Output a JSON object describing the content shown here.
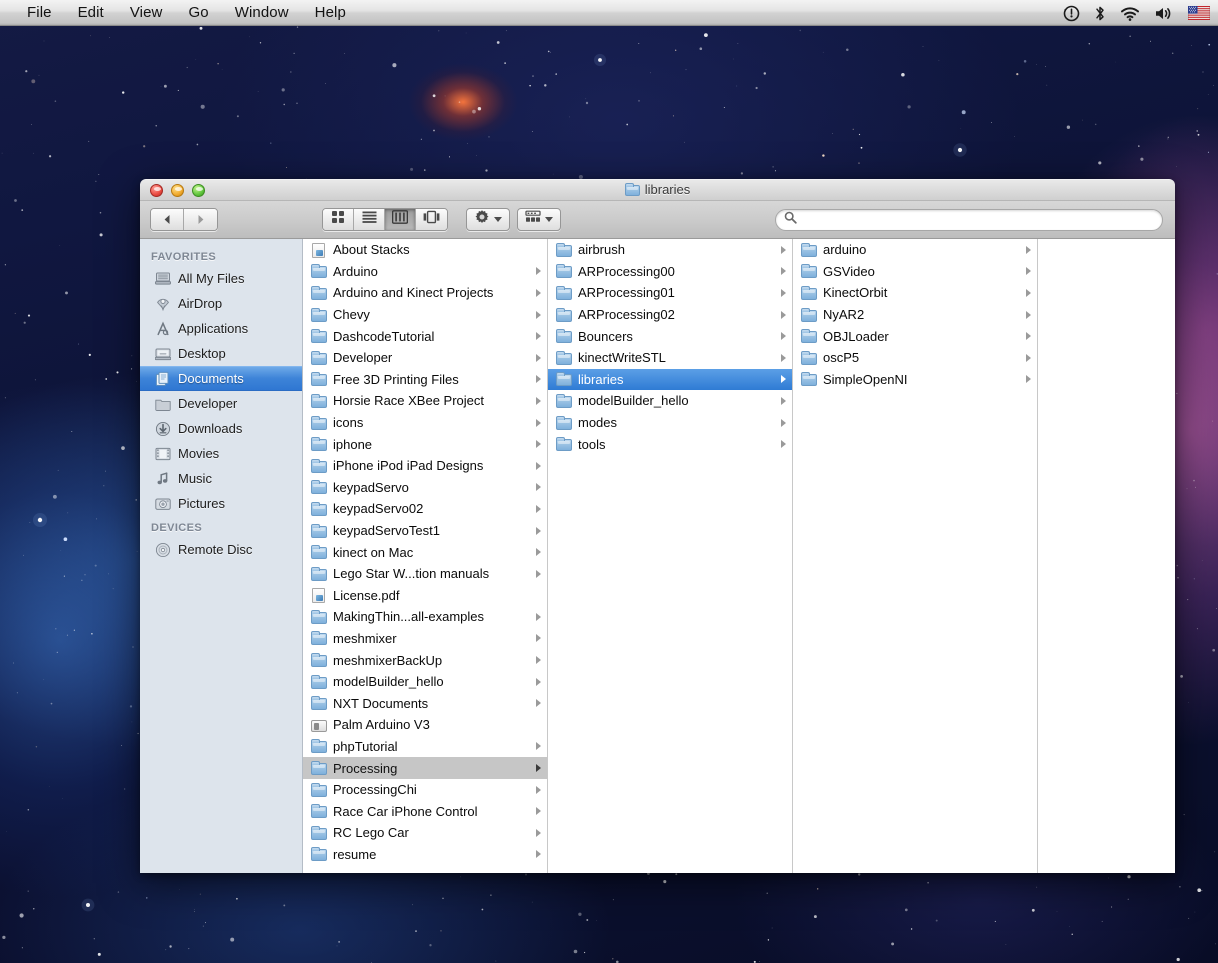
{
  "menubar": {
    "items": [
      "File",
      "Edit",
      "View",
      "Go",
      "Window",
      "Help"
    ],
    "status_icons": [
      "timemachine-alert-icon",
      "bluetooth-icon",
      "wifi-icon",
      "volume-icon",
      "us-flag-icon"
    ]
  },
  "window": {
    "title": "libraries",
    "title_icon": "folder-icon",
    "traffic_lights": [
      "close-button",
      "minimize-button",
      "zoom-button"
    ]
  },
  "toolbar": {
    "nav": {
      "back": "back-arrow-icon",
      "forward": "forward-arrow-icon"
    },
    "view_modes": [
      {
        "name": "icon-view",
        "icon": "grid-icon",
        "active": false
      },
      {
        "name": "list-view",
        "icon": "lines-icon",
        "active": false
      },
      {
        "name": "column-view",
        "icon": "columns-icon",
        "active": true
      },
      {
        "name": "coverflow-view",
        "icon": "coverflow-icon",
        "active": false
      }
    ],
    "action_menu": {
      "name": "action-gear-menu",
      "icon": "gear-icon"
    },
    "arrange_menu": {
      "name": "arrange-by-menu",
      "icon": "arrange-icon"
    },
    "search": {
      "placeholder": "",
      "value": "",
      "icon": "search-icon"
    }
  },
  "sidebar": {
    "sections": [
      {
        "header": "FAVORITES",
        "items": [
          {
            "label": "All My Files",
            "icon": "all-my-files-icon",
            "selected": false
          },
          {
            "label": "AirDrop",
            "icon": "airdrop-icon",
            "selected": false
          },
          {
            "label": "Applications",
            "icon": "applications-icon",
            "selected": false
          },
          {
            "label": "Desktop",
            "icon": "desktop-icon",
            "selected": false
          },
          {
            "label": "Documents",
            "icon": "documents-icon",
            "selected": true
          },
          {
            "label": "Developer",
            "icon": "folder-icon",
            "selected": false
          },
          {
            "label": "Downloads",
            "icon": "downloads-icon",
            "selected": false
          },
          {
            "label": "Movies",
            "icon": "movies-icon",
            "selected": false
          },
          {
            "label": "Music",
            "icon": "music-icon",
            "selected": false
          },
          {
            "label": "Pictures",
            "icon": "pictures-icon",
            "selected": false
          }
        ]
      },
      {
        "header": "DEVICES",
        "items": [
          {
            "label": "Remote Disc",
            "icon": "remote-disc-icon",
            "selected": false
          }
        ]
      }
    ]
  },
  "columns": [
    {
      "name": "column-documents",
      "items": [
        {
          "label": "About Stacks",
          "kind": "doc",
          "chevron": false,
          "state": "none"
        },
        {
          "label": "Arduino",
          "kind": "folder",
          "chevron": true,
          "state": "none"
        },
        {
          "label": "Arduino and Kinect Projects",
          "kind": "folder",
          "chevron": true,
          "state": "none"
        },
        {
          "label": "Chevy",
          "kind": "folder",
          "chevron": true,
          "state": "none"
        },
        {
          "label": "DashcodeTutorial",
          "kind": "folder",
          "chevron": true,
          "state": "none"
        },
        {
          "label": "Developer",
          "kind": "folder",
          "chevron": true,
          "state": "none"
        },
        {
          "label": "Free 3D Printing Files",
          "kind": "folder",
          "chevron": true,
          "state": "none"
        },
        {
          "label": "Horsie Race XBee Project",
          "kind": "folder",
          "chevron": true,
          "state": "none"
        },
        {
          "label": "icons",
          "kind": "folder",
          "chevron": true,
          "state": "none"
        },
        {
          "label": "iphone",
          "kind": "folder",
          "chevron": true,
          "state": "none"
        },
        {
          "label": "iPhone iPod iPad Designs",
          "kind": "folder",
          "chevron": true,
          "state": "none"
        },
        {
          "label": "keypadServo",
          "kind": "folder",
          "chevron": true,
          "state": "none"
        },
        {
          "label": "keypadServo02",
          "kind": "folder",
          "chevron": true,
          "state": "none"
        },
        {
          "label": "keypadServoTest1",
          "kind": "folder",
          "chevron": true,
          "state": "none"
        },
        {
          "label": "kinect on Mac",
          "kind": "folder",
          "chevron": true,
          "state": "none"
        },
        {
          "label": "Lego Star W...tion manuals",
          "kind": "folder",
          "chevron": true,
          "state": "none"
        },
        {
          "label": "License.pdf",
          "kind": "doc",
          "chevron": false,
          "state": "none"
        },
        {
          "label": "MakingThin...all-examples",
          "kind": "folder",
          "chevron": true,
          "state": "none"
        },
        {
          "label": "meshmixer",
          "kind": "folder",
          "chevron": true,
          "state": "none"
        },
        {
          "label": "meshmixerBackUp",
          "kind": "folder",
          "chevron": true,
          "state": "none"
        },
        {
          "label": "modelBuilder_hello",
          "kind": "folder",
          "chevron": true,
          "state": "none"
        },
        {
          "label": "NXT Documents",
          "kind": "folder",
          "chevron": true,
          "state": "none"
        },
        {
          "label": "Palm Arduino V3",
          "kind": "widget",
          "chevron": false,
          "state": "none"
        },
        {
          "label": "phpTutorial",
          "kind": "folder",
          "chevron": true,
          "state": "none"
        },
        {
          "label": "Processing",
          "kind": "folder",
          "chevron": true,
          "state": "selected-inactive"
        },
        {
          "label": "ProcessingChi",
          "kind": "folder",
          "chevron": true,
          "state": "none"
        },
        {
          "label": "Race Car iPhone Control",
          "kind": "folder",
          "chevron": true,
          "state": "none"
        },
        {
          "label": "RC Lego Car",
          "kind": "folder",
          "chevron": true,
          "state": "none"
        },
        {
          "label": "resume",
          "kind": "folder",
          "chevron": true,
          "state": "none"
        }
      ]
    },
    {
      "name": "column-processing",
      "items": [
        {
          "label": "airbrush",
          "kind": "folder",
          "chevron": true,
          "state": "none"
        },
        {
          "label": "ARProcessing00",
          "kind": "folder",
          "chevron": true,
          "state": "none"
        },
        {
          "label": "ARProcessing01",
          "kind": "folder",
          "chevron": true,
          "state": "none"
        },
        {
          "label": "ARProcessing02",
          "kind": "folder",
          "chevron": true,
          "state": "none"
        },
        {
          "label": "Bouncers",
          "kind": "folder",
          "chevron": true,
          "state": "none"
        },
        {
          "label": "kinectWriteSTL",
          "kind": "folder",
          "chevron": true,
          "state": "none"
        },
        {
          "label": "libraries",
          "kind": "folder",
          "chevron": true,
          "state": "selected-active"
        },
        {
          "label": "modelBuilder_hello",
          "kind": "folder",
          "chevron": true,
          "state": "none"
        },
        {
          "label": "modes",
          "kind": "folder",
          "chevron": true,
          "state": "none"
        },
        {
          "label": "tools",
          "kind": "folder",
          "chevron": true,
          "state": "none"
        }
      ]
    },
    {
      "name": "column-libraries",
      "items": [
        {
          "label": "arduino",
          "kind": "folder",
          "chevron": true,
          "state": "none"
        },
        {
          "label": "GSVideo",
          "kind": "folder",
          "chevron": true,
          "state": "none"
        },
        {
          "label": "KinectOrbit",
          "kind": "folder",
          "chevron": true,
          "state": "none"
        },
        {
          "label": "NyAR2",
          "kind": "folder",
          "chevron": true,
          "state": "none"
        },
        {
          "label": "OBJLoader",
          "kind": "folder",
          "chevron": true,
          "state": "none"
        },
        {
          "label": "oscP5",
          "kind": "folder",
          "chevron": true,
          "state": "none"
        },
        {
          "label": "SimpleOpenNI",
          "kind": "folder",
          "chevron": true,
          "state": "none"
        }
      ]
    },
    {
      "name": "column-preview",
      "items": []
    }
  ],
  "colors": {
    "selection_blue": "#2f7bd4",
    "sidebar_bg": "#dde4ec",
    "inactive_selection": "#c6c6c6"
  }
}
